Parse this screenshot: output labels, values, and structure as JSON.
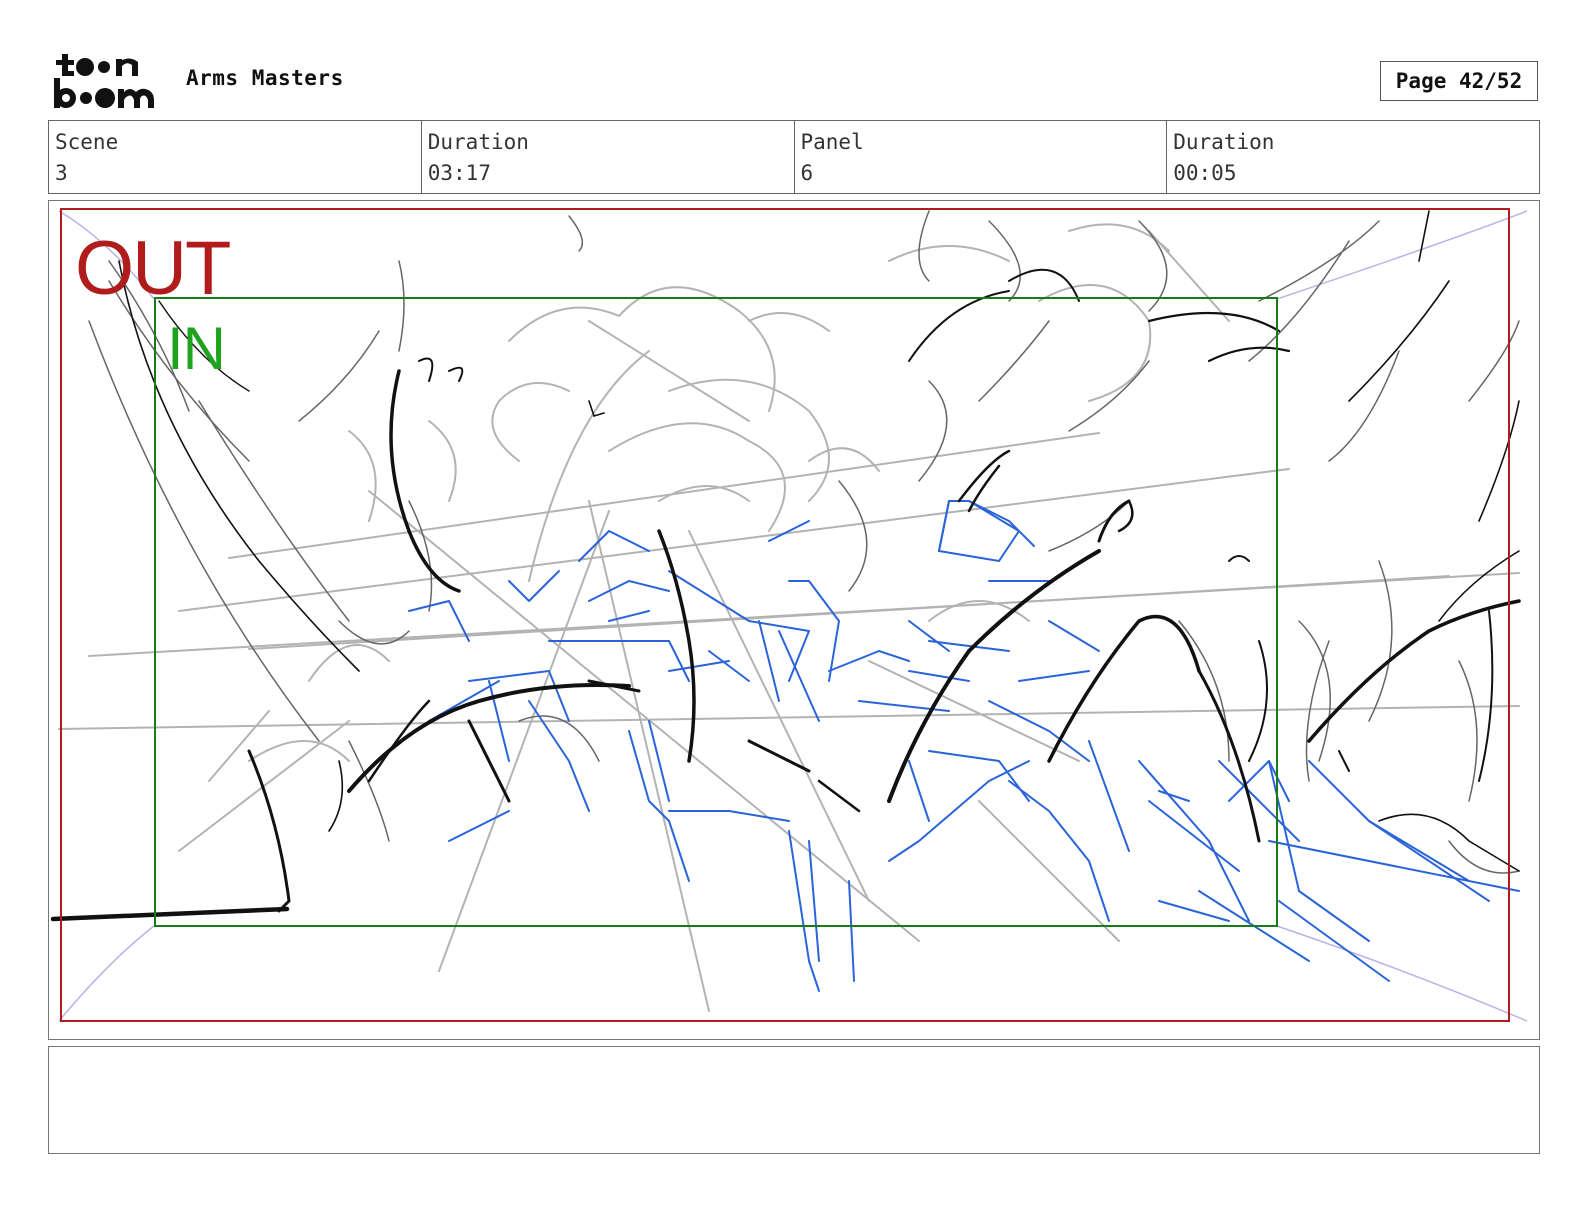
{
  "header": {
    "logo_text": "toon boom",
    "project_title": "Arms Masters",
    "page_label": "Page 42/52"
  },
  "info": [
    {
      "label": "Scene",
      "value": "3"
    },
    {
      "label": "Duration",
      "value": "03:17"
    },
    {
      "label": "Panel",
      "value": "6"
    },
    {
      "label": "Duration",
      "value": "00:05"
    }
  ],
  "panel": {
    "out_label": "OUT",
    "in_label": "IN",
    "colors": {
      "out_frame": "#b01c1c",
      "in_frame": "#1a7a1a",
      "sketch_black": "#111111",
      "sketch_gray": "#a8a8a8",
      "sketch_blue": "#2a64d8"
    }
  },
  "notes": {
    "text": ""
  }
}
